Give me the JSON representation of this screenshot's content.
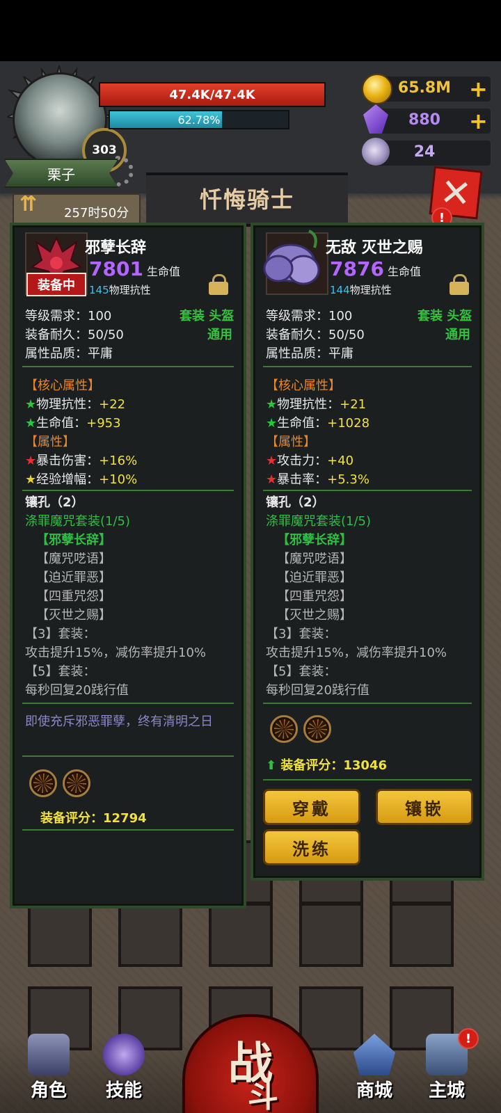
{
  "player": {
    "hp": "47.4K/47.4K",
    "hp_fraction": 1.0,
    "mp": "62.78%",
    "mp_fraction": 0.6278,
    "level": "303",
    "name": "栗子"
  },
  "resources": {
    "gold": "65.8M",
    "gems": "880",
    "tokens": "24",
    "plus": "+"
  },
  "header": {
    "title": "忏悔骑士",
    "timer": "257时50分",
    "close_symbol": "✕",
    "alert": "!"
  },
  "left_panel": {
    "name": "邪孽长辞",
    "equipped_tag": "装备中",
    "hp_value": "7801",
    "hp_label": "生命值",
    "def_value": "145",
    "def_label": "物理抗性",
    "level_req": "等级需求：100",
    "set_tag": "套装 头盔",
    "durability": "装备耐久：50/50",
    "usage": "通用",
    "quality": "属性品质：平庸",
    "core_header": "【核心属性】",
    "core": [
      {
        "star": "★",
        "label": "物理抗性：",
        "value": "+22"
      },
      {
        "star": "★",
        "label": "生命值：",
        "value": "+953"
      }
    ],
    "attr_header": "【属性】",
    "attrs": [
      {
        "star": "★",
        "label": "暴击伤害：",
        "value": "+16%",
        "color": "red"
      },
      {
        "star": "★",
        "label": "经验增幅：",
        "value": "+10%",
        "color": "yellow"
      }
    ],
    "sockets": "镶孔（2）",
    "set_name": "涤罪魔咒套装(1/5)",
    "set_items": [
      "【邪孽长辞】",
      "【魔咒呓语】",
      "【迫近罪恶】",
      "【四重咒怨】",
      "【灭世之赐】"
    ],
    "set_bonus3_title": "【3】套装：",
    "set_bonus3": "攻击提升15%，减伤率提升10%",
    "set_bonus5_title": "【5】套装：",
    "set_bonus5": "每秒回复20践行值",
    "flavor": "即使充斥邪恶罪孽，终有清明之日",
    "score": "装备评分：12794"
  },
  "right_panel": {
    "name": "无敌 灭世之赐",
    "hp_value": "7876",
    "hp_label": "生命值",
    "def_value": "144",
    "def_label": "物理抗性",
    "level_req": "等级需求：100",
    "set_tag": "套装 头盔",
    "durability": "装备耐久：50/50",
    "usage": "通用",
    "quality": "属性品质：平庸",
    "core_header": "【核心属性】",
    "core": [
      {
        "star": "★",
        "label": "物理抗性：",
        "value": "+21"
      },
      {
        "star": "★",
        "label": "生命值：",
        "value": "+1028"
      }
    ],
    "attr_header": "【属性】",
    "attrs": [
      {
        "star": "★",
        "label": "攻击力：",
        "value": "+40",
        "color": "red"
      },
      {
        "star": "★",
        "label": "暴击率：",
        "value": "+5.3%",
        "color": "red"
      }
    ],
    "sockets": "镶孔（2）",
    "set_name": "涤罪魔咒套装(1/5)",
    "set_items": [
      "【邪孽长辞】",
      "【魔咒呓语】",
      "【迫近罪恶】",
      "【四重咒怨】",
      "【灭世之赐】"
    ],
    "set_bonus3_title": "【3】套装：",
    "set_bonus3": "攻击提升15%，减伤率提升10%",
    "set_bonus5_title": "【5】套装：",
    "set_bonus5": "每秒回复20践行值",
    "score_arrow": "⬆",
    "score": "装备评分：13046",
    "buttons": {
      "wear": "穿戴",
      "inlay": "镶嵌",
      "refine": "洗练"
    }
  },
  "nav": {
    "role": "角色",
    "skill": "技能",
    "battle_1": "战",
    "battle_2": "斗",
    "shop": "商城",
    "city": "主城"
  },
  "colors": {
    "hp_bar": "#c8261b",
    "mp_bar": "#3fc4d9",
    "panel_border": "#2f4a2b",
    "accent_gold": "#f3c63c"
  }
}
